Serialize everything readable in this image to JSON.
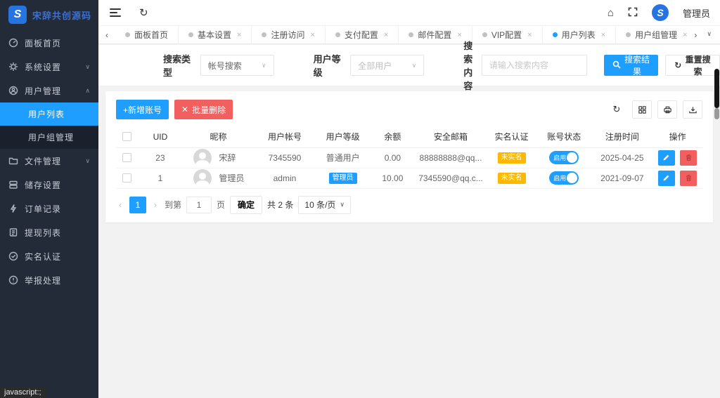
{
  "app": {
    "logo_text": "宋辞共创源码",
    "logo_letter": "S",
    "colors": {
      "primary": "#1e9fff",
      "danger": "#f15f5f",
      "warning": "#ffb800",
      "sidebar_bg": "#232b38"
    }
  },
  "glyphs": {
    "chevron_down": "∨",
    "chevron_up": "∧",
    "chevron_left": "‹",
    "chevron_right": "›",
    "refresh": "↻",
    "home": "⌂",
    "close": "×",
    "plus": "+",
    "cross": "✕"
  },
  "topbar": {
    "username": "管理员",
    "avatar_letter": "S"
  },
  "sidebar": {
    "items": [
      {
        "label": "面板首页"
      },
      {
        "label": "系统设置"
      },
      {
        "label": "用户管理"
      },
      {
        "label": "文件管理"
      },
      {
        "label": "储存设置"
      },
      {
        "label": "订单记录"
      },
      {
        "label": "提现列表"
      },
      {
        "label": "实名认证"
      },
      {
        "label": "举报处理"
      }
    ],
    "submenu": [
      {
        "label": "用户列表",
        "active": true
      },
      {
        "label": "用户组管理",
        "active": false
      }
    ]
  },
  "tabs": [
    {
      "label": "面板首页",
      "closable": false,
      "active": false
    },
    {
      "label": "基本设置",
      "closable": true,
      "active": false
    },
    {
      "label": "注册访问",
      "closable": true,
      "active": false
    },
    {
      "label": "支付配置",
      "closable": true,
      "active": false
    },
    {
      "label": "邮件配置",
      "closable": true,
      "active": false
    },
    {
      "label": "VIP配置",
      "closable": true,
      "active": false
    },
    {
      "label": "用户列表",
      "closable": true,
      "active": true
    },
    {
      "label": "用户组管理",
      "closable": true,
      "active": false
    }
  ],
  "search": {
    "type_label": "搜索类型",
    "type_value": "帐号搜索",
    "level_label": "用户等级",
    "level_value": "全部用户",
    "content_label": "搜索内容",
    "content_placeholder": "请输入搜索内容",
    "search_button": "搜索结果",
    "reset_button": "重置搜索"
  },
  "toolbar": {
    "add_button": "+新增账号",
    "delete_button": "批量删除"
  },
  "table": {
    "headers": {
      "uid": "UID",
      "nickname": "昵称",
      "account": "用户帐号",
      "level": "用户等级",
      "balance": "余额",
      "email": "安全邮箱",
      "realname": "实名认证",
      "status": "账号状态",
      "regtime": "注册时间",
      "ops": "操作"
    },
    "rows": [
      {
        "uid": "23",
        "nickname": "宋辞",
        "account": "7345590",
        "level": "普通用户",
        "balance": "0.00",
        "email": "88888888@qq...",
        "realname": "未实名",
        "status": "启用",
        "regtime": "2025-04-25"
      },
      {
        "uid": "1",
        "nickname": "管理员",
        "account": "admin",
        "level": "管理员",
        "balance": "10.00",
        "email": "7345590@qq.c...",
        "realname": "未实名",
        "status": "启用",
        "regtime": "2021-09-07"
      }
    ]
  },
  "pagination": {
    "page": "1",
    "goto_prefix": "到第",
    "goto_value": "1",
    "goto_suffix": "页",
    "confirm": "确定",
    "total": "共 2 条",
    "per_page": "10 条/页"
  },
  "statusbar": {
    "text": "javascript:;"
  }
}
